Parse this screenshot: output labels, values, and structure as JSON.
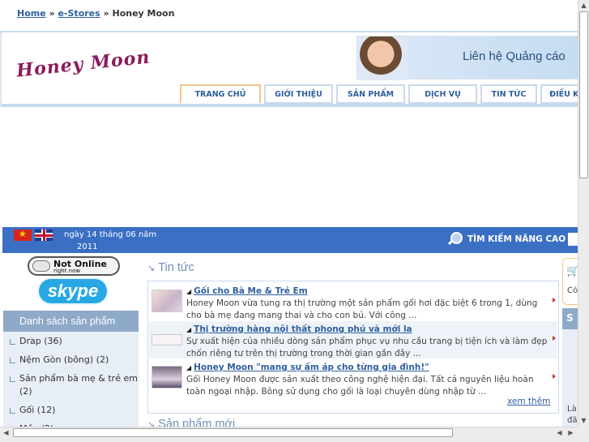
{
  "breadcrumb": {
    "home": "Home",
    "sep1": "»",
    "estores": "e-Stores",
    "sep2": "»",
    "current": "Honey Moon"
  },
  "header": {
    "logo_text": "Honey Moon",
    "ad_text": "Liên hệ Quảng cáo",
    "nav": [
      "TRANG CHỦ",
      "GIỚI THIỆU",
      "SẢN PHẨM",
      "DỊCH VỤ",
      "TIN TỨC",
      "ĐIỀU KHOẢN"
    ]
  },
  "bar": {
    "date_line1": "ngày 14 tháng 06 năm",
    "date_line2": "2011",
    "search_label": "TÌM KIẾM NÂNG CAO"
  },
  "sidebar": {
    "status_title": "Not Online",
    "status_sub": "right now",
    "skype_label": "skype",
    "categories_header": "Danh sách sản phẩm",
    "categories": [
      "Drap (36)",
      "Nệm Gòn (bông) (2)",
      "Sản phẩm bà mẹ & trẻ em (2)",
      "Gối (12)",
      "Mền (2)"
    ]
  },
  "main": {
    "news_title": "Tin tức",
    "news": [
      {
        "title": "Gối cho Bà Me & Trẻ Em",
        "desc": "Honey Moon vừa tung ra thị trường một sản phẩm gối hơi đặc biệt 6 trong 1, dùng cho bà mẹ đang mang thai và cho con bú. Với công ..."
      },
      {
        "title": "Thị trường hàng nội thất phong phú và mới la",
        "desc": "Sự xuất hiện của nhiều dòng sản phẩm phục vụ nhu cầu trang bị tiện ích và làm đẹp chốn riêng tư trên thị trường trong thời gian gần đây ..."
      },
      {
        "title": "Honey Moon \"mang sự ấm áp cho từng gia đình!\"",
        "desc": "Gối Honey Moon được sản xuất theo công nghệ hiện đại. Tất cả nguyên liệu hoàn toàn ngoại nhập. Bông sử dụng cho gối là loại chuyên dùng nhập từ ..."
      }
    ],
    "more_label": "xem thêm",
    "new_products_title": "Sản phẩm mới"
  },
  "right": {
    "cart_text": "Có",
    "header_letter": "S",
    "text_line1": "Là",
    "text_line2": "đã"
  },
  "colors": {
    "accent": "#3a6fc4",
    "link": "#2f5f9e",
    "panel": "#8fa9c8",
    "highlight": "#f3c48c"
  }
}
